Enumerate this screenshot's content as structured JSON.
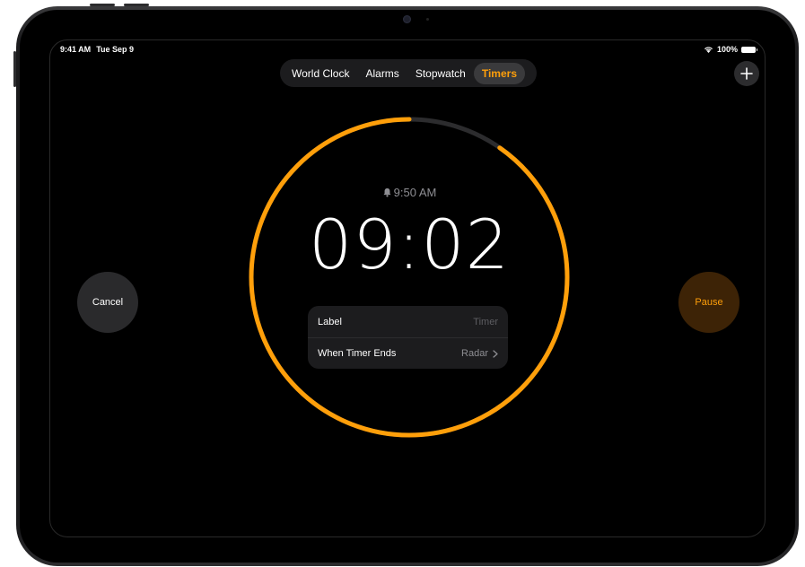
{
  "status_bar": {
    "time": "9:41 AM",
    "date": "Tue Sep 9",
    "battery": "100%"
  },
  "tabs": [
    {
      "label": "World Clock",
      "active": false
    },
    {
      "label": "Alarms",
      "active": false
    },
    {
      "label": "Stopwatch",
      "active": false
    },
    {
      "label": "Timers",
      "active": true
    }
  ],
  "timer": {
    "alarm_time": "9:50 AM",
    "remaining": "09:02",
    "progress_remaining": 0.903,
    "label_title": "Label",
    "label_value": "Timer",
    "end_title": "When Timer Ends",
    "end_value": "Radar"
  },
  "buttons": {
    "cancel": "Cancel",
    "pause": "Pause"
  },
  "colors": {
    "accent": "#ff9f0a",
    "track": "#2c2c2e",
    "background": "#000000"
  },
  "icons": {
    "add": "plus-icon",
    "bell": "bell-icon",
    "wifi": "wifi-icon",
    "battery": "battery-icon",
    "chevron": "chevron-right-icon"
  }
}
